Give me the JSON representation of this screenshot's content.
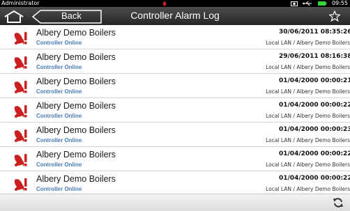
{
  "statusbar": {
    "user": "Administrator",
    "time": "09:55"
  },
  "titlebar": {
    "back_label": "Back",
    "title": "Controller Alarm Log"
  },
  "alarms": [
    {
      "name": "Albery Demo Boilers",
      "status": "Controller Online",
      "date": "30/06/2011 08:35:26",
      "network": "Local LAN / Albery Demo Boilers"
    },
    {
      "name": "Albery Demo Boilers",
      "status": "Controller Online",
      "date": "29/06/2011 08:16:38",
      "network": "Local LAN / Albery Demo Boilers"
    },
    {
      "name": "Albery Demo Boilers",
      "status": "Controller Online",
      "date": "01/04/2000 00:00:21",
      "network": "Local LAN / Albery Demo Boilers"
    },
    {
      "name": "Albery Demo Boilers",
      "status": "Controller Online",
      "date": "01/04/2000 00:00:22",
      "network": "Local LAN / Albery Demo Boilers"
    },
    {
      "name": "Albery Demo Boilers",
      "status": "Controller Online",
      "date": "01/04/2000 00:00:23",
      "network": "Local LAN / Albery Demo Boilers"
    },
    {
      "name": "Albery Demo Boilers",
      "status": "Controller Online",
      "date": "01/04/2000 00:00:22",
      "network": "Local LAN / Albery Demo Boilers"
    },
    {
      "name": "Albery Demo Boilers",
      "status": "Controller Online",
      "date": "01/04/2000 00:00:22",
      "network": "Local LAN / Albery Demo Boilers"
    }
  ],
  "icons": {
    "alarm": "alarm-bell-icon",
    "home": "home-icon",
    "back": "back-arrow-icon",
    "favourite": "star-icon",
    "refresh": "refresh-icon",
    "screenshot": "camera-icon",
    "usb": "usb-icon",
    "battery": "battery-icon"
  },
  "colors": {
    "alarm_red": "#cc1f1f",
    "status_blue": "#4a7bb7",
    "titlebar": "#333333"
  }
}
